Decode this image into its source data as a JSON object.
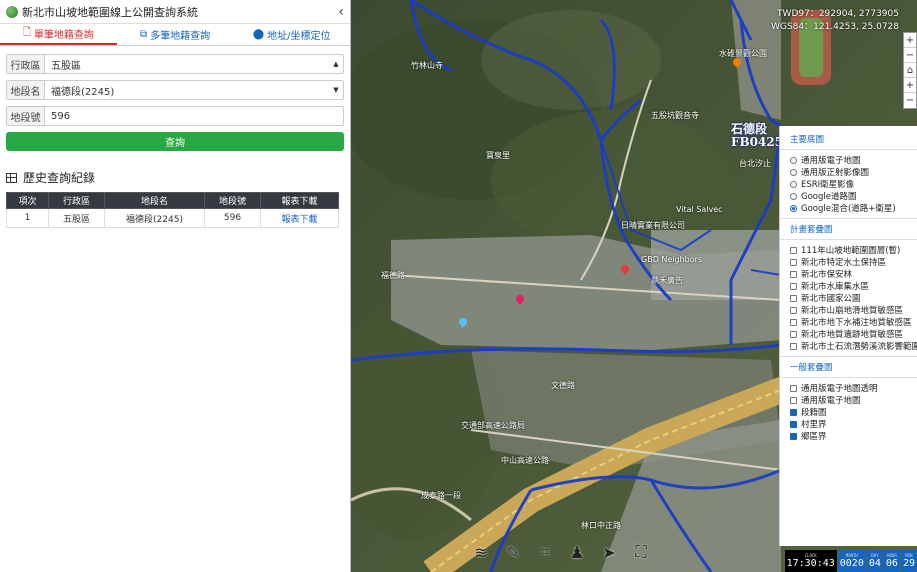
{
  "header": {
    "title": "新北市山坡地範圍線上公開查詢系統",
    "collapse_icon": "chevron-left-icon"
  },
  "tabs": [
    {
      "label": "單筆地籍查詢",
      "icon": "file-icon",
      "active": true
    },
    {
      "label": "多筆地籍查詢",
      "icon": "files-icon",
      "active": false
    },
    {
      "label": "地址/坐標定位",
      "icon": "map-marker-icon",
      "active": false
    }
  ],
  "form": {
    "district": {
      "label": "行政區",
      "value": "五股區"
    },
    "section": {
      "label": "地段名",
      "value": "福德段(2245)"
    },
    "parcel": {
      "label": "地段號",
      "value": "596"
    },
    "query_label": "查詢"
  },
  "history": {
    "title": "歷史查詢紀錄",
    "columns": [
      "項次",
      "行政區",
      "地段名",
      "地段號",
      "報表下載"
    ],
    "rows": [
      {
        "no": "1",
        "district": "五股區",
        "section": "福德段(2245)",
        "parcel": "596",
        "download": "報表下載"
      }
    ]
  },
  "map": {
    "twd97": "TWD97：292904, 2773905",
    "wgs84": "WGS84：121.4253, 25.0728",
    "parcel_label_line1": "石德段",
    "parcel_label_line2": "FB0425",
    "zoom_in": "+",
    "zoom_out": "−",
    "labels": [
      "竹林山寺",
      "五股坑觀音寺",
      "水碓景觀公園",
      "台北汐止",
      "寶泉里",
      "Vital Salvec",
      "日晴實業有限公司",
      "GBD Neighbors",
      "鼎禾廣告",
      "文德路",
      "福德路",
      "交通部高速公路局",
      "中山高速公路",
      "成泰路一段",
      "林口中正路"
    ]
  },
  "layers": {
    "basemap_title": "主要底圖",
    "basemaps": [
      {
        "label": "通用版電子地圖",
        "selected": false
      },
      {
        "label": "通用版正射影像圖",
        "selected": false
      },
      {
        "label": "ESRI衛星影像",
        "selected": false
      },
      {
        "label": "Google道路圖",
        "selected": false
      },
      {
        "label": "Google混合(道路+衛星)",
        "selected": true
      }
    ],
    "plan_title": "計畫套疊圖",
    "plans": [
      {
        "label": "111年山坡地範圍圖層(暫)",
        "checked": false
      },
      {
        "label": "新北市特定水土保持區",
        "checked": false
      },
      {
        "label": "新北市保安林",
        "checked": false
      },
      {
        "label": "新北市水庫集水區",
        "checked": false
      },
      {
        "label": "新北市國家公園",
        "checked": false
      },
      {
        "label": "新北市山崩地滑地質敏感區",
        "checked": false
      },
      {
        "label": "新北市地下水補注地質敏感區",
        "checked": false
      },
      {
        "label": "新北市地質遺跡地質敏感區",
        "checked": false
      },
      {
        "label": "新北市土石流潛勢溪流影響範圍",
        "checked": false
      }
    ],
    "general_title": "一般套疊圖",
    "generals": [
      {
        "label": "通用版電子地圖透明",
        "checked": false
      },
      {
        "label": "通用版電子地圖",
        "checked": false
      },
      {
        "label": "段籍圖",
        "checked": true
      },
      {
        "label": "村里界",
        "checked": true
      },
      {
        "label": "鄉區界",
        "checked": true
      }
    ]
  },
  "clock": {
    "clock_key": "CLOCK",
    "clock_val": "17:30:43",
    "month_key": "MONTH",
    "month_val": "0020",
    "day_key": "DAY",
    "day_val": "04",
    "hour_key": "HOUR",
    "hour_val": "06",
    "min_key": "MIN",
    "min_val": "29"
  },
  "colors": {
    "accent_red": "#d32f2f",
    "link_blue": "#1565c0",
    "query_green": "#28a745",
    "table_header": "#343a40",
    "boundary_blue": "#1a3cc8"
  }
}
